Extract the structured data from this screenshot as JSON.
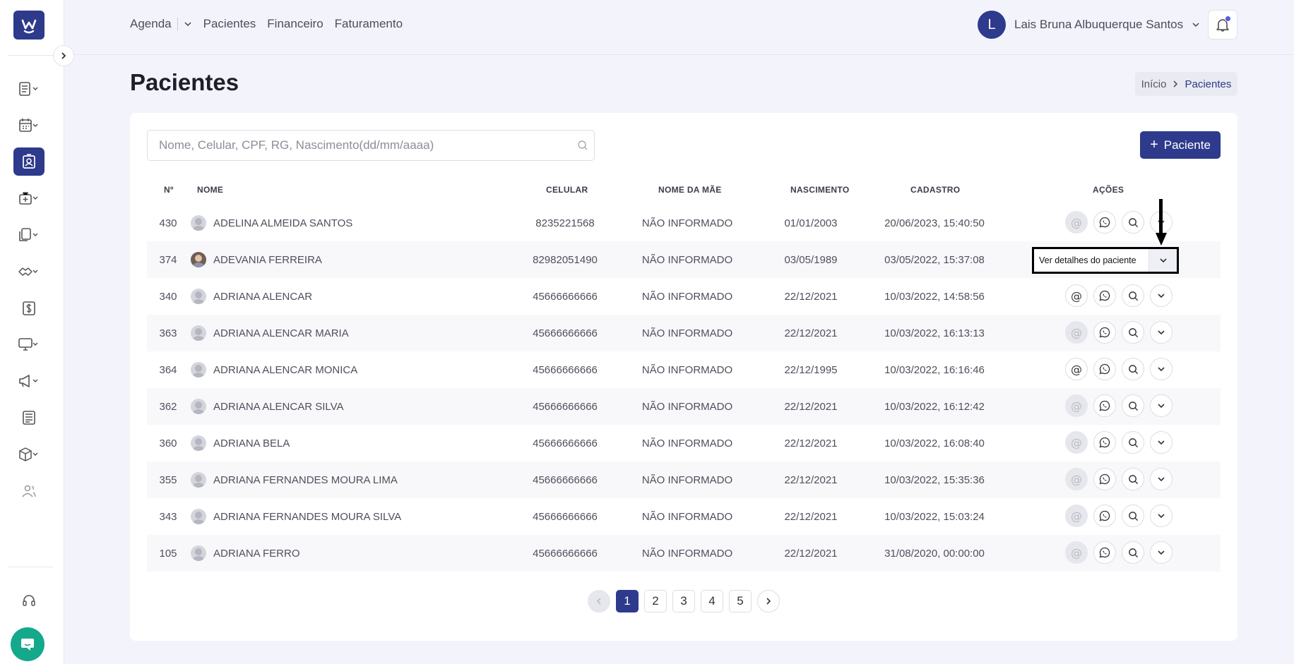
{
  "nav": {
    "agenda": "Agenda",
    "pacientes": "Pacientes",
    "financeiro": "Financeiro",
    "faturamento": "Faturamento"
  },
  "user": {
    "initial": "L",
    "name": "Lais Bruna Albuquerque Santos"
  },
  "page": {
    "title": "Pacientes"
  },
  "breadcrumb": {
    "home": "Início",
    "current": "Pacientes"
  },
  "search": {
    "placeholder": "Nome, Celular, CPF, RG, Nascimento(dd/mm/aaaa)",
    "value": ""
  },
  "add_button": {
    "plus": "+",
    "label": "Paciente"
  },
  "table": {
    "headers": {
      "num": "Nº",
      "nome": "NOME",
      "celular": "CELULAR",
      "mae": "NOME DA MÃE",
      "nascimento": "NASCIMENTO",
      "cadastro": "CADASTRO",
      "acoes": "AÇÕES"
    },
    "rows": [
      {
        "num": "430",
        "nome": "ADELINA ALMEIDA SANTOS",
        "celular": "8235221568",
        "mae": "NÃO INFORMADO",
        "nascimento": "01/01/2003",
        "cadastro": "20/06/2023, 15:40:50",
        "email_enabled": false,
        "photo": false
      },
      {
        "num": "374",
        "nome": "ADEVANIA FERREIRA",
        "celular": "82982051490",
        "mae": "NÃO INFORMADO",
        "nascimento": "03/05/1989",
        "cadastro": "03/05/2022, 15:37:08",
        "email_enabled": false,
        "photo": true
      },
      {
        "num": "340",
        "nome": "ADRIANA ALENCAR",
        "celular": "45666666666",
        "mae": "NÃO INFORMADO",
        "nascimento": "22/12/2021",
        "cadastro": "10/03/2022, 14:58:56",
        "email_enabled": true,
        "photo": false
      },
      {
        "num": "363",
        "nome": "ADRIANA ALENCAR MARIA",
        "celular": "45666666666",
        "mae": "NÃO INFORMADO",
        "nascimento": "22/12/2021",
        "cadastro": "10/03/2022, 16:13:13",
        "email_enabled": false,
        "photo": false
      },
      {
        "num": "364",
        "nome": "ADRIANA ALENCAR MONICA",
        "celular": "45666666666",
        "mae": "NÃO INFORMADO",
        "nascimento": "22/12/1995",
        "cadastro": "10/03/2022, 16:16:46",
        "email_enabled": true,
        "photo": false
      },
      {
        "num": "362",
        "nome": "ADRIANA ALENCAR SILVA",
        "celular": "45666666666",
        "mae": "NÃO INFORMADO",
        "nascimento": "22/12/2021",
        "cadastro": "10/03/2022, 16:12:42",
        "email_enabled": false,
        "photo": false
      },
      {
        "num": "360",
        "nome": "ADRIANA BELA",
        "celular": "45666666666",
        "mae": "NÃO INFORMADO",
        "nascimento": "22/12/2021",
        "cadastro": "10/03/2022, 16:08:40",
        "email_enabled": false,
        "photo": false
      },
      {
        "num": "355",
        "nome": "ADRIANA FERNANDES MOURA LIMA",
        "celular": "45666666666",
        "mae": "NÃO INFORMADO",
        "nascimento": "22/12/2021",
        "cadastro": "10/03/2022, 15:35:36",
        "email_enabled": false,
        "photo": false
      },
      {
        "num": "343",
        "nome": "ADRIANA FERNANDES MOURA SILVA",
        "celular": "45666666666",
        "mae": "NÃO INFORMADO",
        "nascimento": "22/12/2021",
        "cadastro": "10/03/2022, 15:03:24",
        "email_enabled": false,
        "photo": false
      },
      {
        "num": "105",
        "nome": "ADRIANA FERRO",
        "celular": "45666666666",
        "mae": "NÃO INFORMADO",
        "nascimento": "22/12/2021",
        "cadastro": "31/08/2020, 00:00:00",
        "email_enabled": false,
        "photo": false
      }
    ]
  },
  "row_dropdown": {
    "label": "Ver detalhes do paciente"
  },
  "pagination": {
    "pages": [
      "1",
      "2",
      "3",
      "4",
      "5"
    ],
    "current": "1"
  },
  "icons": {
    "email": "at-icon",
    "whatsapp": "whatsapp-icon",
    "view": "search-icon",
    "more": "chevron-down-icon"
  },
  "colors": {
    "primary": "#2e3a8c",
    "chat": "#14a98a",
    "notification_dot": "#4f5de8"
  }
}
